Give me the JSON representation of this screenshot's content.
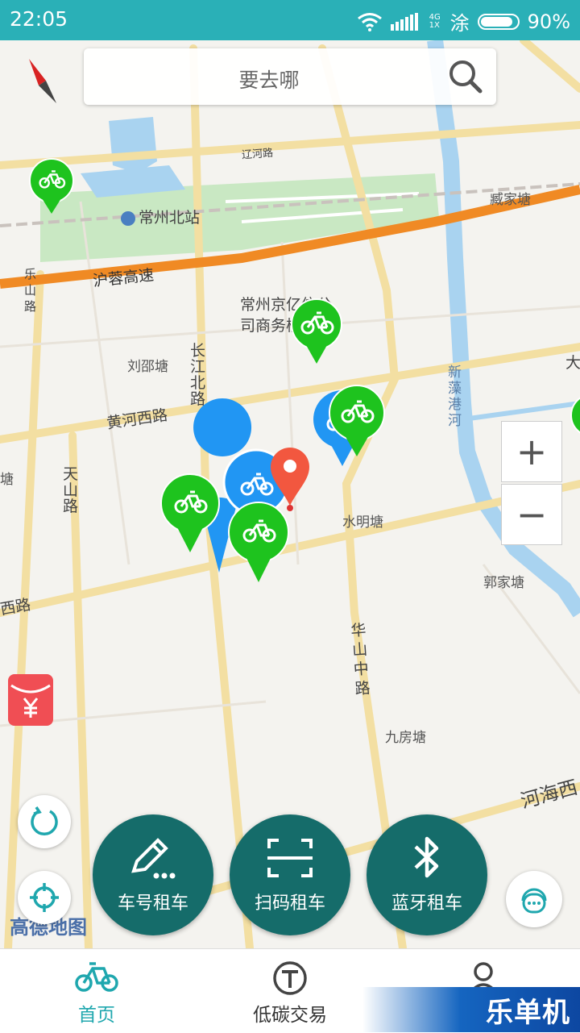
{
  "status_bar": {
    "time": "22:05",
    "network": "4G 1X",
    "app_indicator": "涂",
    "battery": "90%",
    "battery_level": 0.9
  },
  "search": {
    "placeholder": "要去哪"
  },
  "map": {
    "places": [
      "常州北站",
      "常州京亿信公司商务楼",
      "刘邵塘",
      "臧家塘",
      "水明塘",
      "郭家塘",
      "九房塘",
      "塘"
    ],
    "roads": [
      "沪蓉高速",
      "黄河西路",
      "长江北路",
      "天山路",
      "华山中路",
      "河海西",
      "新藻港河",
      "乐山路",
      "辽河路",
      "西路",
      "大"
    ],
    "poi_text_1": "常州京亿信公",
    "poi_text_2": "司商务楼",
    "attribution": "高德地图"
  },
  "zoom": {
    "in": "+",
    "out": "−"
  },
  "actions": [
    {
      "label": "车号租车",
      "icon": "pencil-icon"
    },
    {
      "label": "扫码租车",
      "icon": "scan-icon"
    },
    {
      "label": "蓝牙租车",
      "icon": "bluetooth-icon"
    }
  ],
  "tabs": [
    {
      "label": "首页",
      "active": true
    },
    {
      "label": "低碳交易",
      "active": false
    },
    {
      "label": "我的",
      "active": false
    }
  ],
  "watermark": "乐单机",
  "colors": {
    "status_bar": "#2ab0b7",
    "action_button": "#156c6a",
    "active_tab": "#1fa7ae",
    "pin_green": "#1ec31e",
    "pin_blue": "#2196f3",
    "location_pin": "#f2573f",
    "red_packet": "#f04e54"
  }
}
